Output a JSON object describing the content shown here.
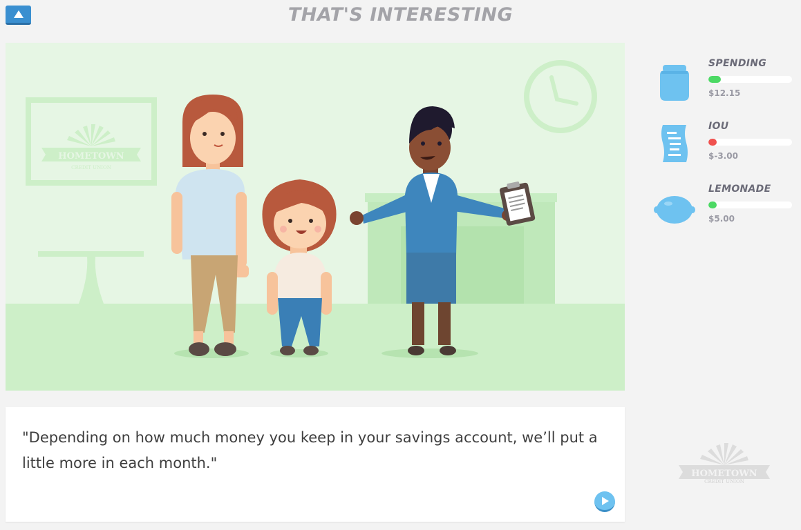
{
  "header": {
    "title": "THAT'S INTERESTING",
    "up_icon": "triangle-up-icon"
  },
  "scene": {
    "sign_line1": "HOMETOWN",
    "sign_line2": "CREDIT UNION"
  },
  "dialog": {
    "text": "\"Depending on how much money you keep in your savings account, we’ll put a little more in each month.\"",
    "play_icon": "play-icon"
  },
  "stats": [
    {
      "label": "SPENDING",
      "value": "$12.15",
      "icon": "jar-icon",
      "bar_color": "#4cd964",
      "fill_pct": 15
    },
    {
      "label": "IOU",
      "value": "$-3.00",
      "icon": "receipt-icon",
      "bar_color": "#f0524f",
      "fill_pct": 10
    },
    {
      "label": "LEMONADE",
      "value": "$5.00",
      "icon": "lemon-icon",
      "bar_color": "#4cd964",
      "fill_pct": 10
    }
  ],
  "corner_logo": {
    "line1": "HOMETOWN",
    "line2": "CREDIT UNION"
  },
  "colors": {
    "accent": "#3a8fd0",
    "stat_icon": "#6ec2f0",
    "scene_bg": "#e6f6e4"
  }
}
